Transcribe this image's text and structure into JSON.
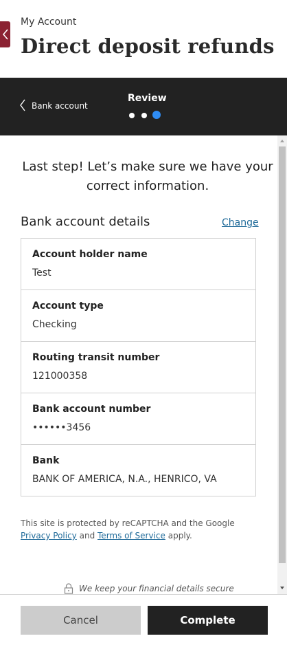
{
  "header": {
    "eyebrow": "My Account",
    "title": "Direct deposit refunds"
  },
  "stepper": {
    "back_label": "Bank account",
    "current_step": "Review",
    "total_steps": 3,
    "active_step": 3,
    "active_color": "#2f8df5"
  },
  "intro": "Last step! Let’s make sure we have your correct information.",
  "bank_details": {
    "title": "Bank account details",
    "change_label": "Change",
    "rows": [
      {
        "label": "Account holder name",
        "value": "Test"
      },
      {
        "label": "Account type",
        "value": "Checking"
      },
      {
        "label": "Routing transit number",
        "value": "121000358"
      },
      {
        "label": "Bank account number",
        "value": "••••••3456"
      },
      {
        "label": "Bank",
        "value": "BANK OF AMERICA, N.A., HENRICO, VA"
      }
    ]
  },
  "recaptcha": {
    "prefix": "This site is protected by reCAPTCHA and the Google",
    "privacy_label": "Privacy Policy",
    "and": "and",
    "terms_label": "Terms of Service",
    "suffix": "apply."
  },
  "secure_note": "We keep your financial details secure",
  "footer": {
    "cancel_label": "Cancel",
    "complete_label": "Complete"
  },
  "colors": {
    "brand": "#8b2232",
    "dark": "#222222",
    "link": "#1f6a99"
  },
  "icons": [
    "chevron-left-icon",
    "lock-icon"
  ]
}
